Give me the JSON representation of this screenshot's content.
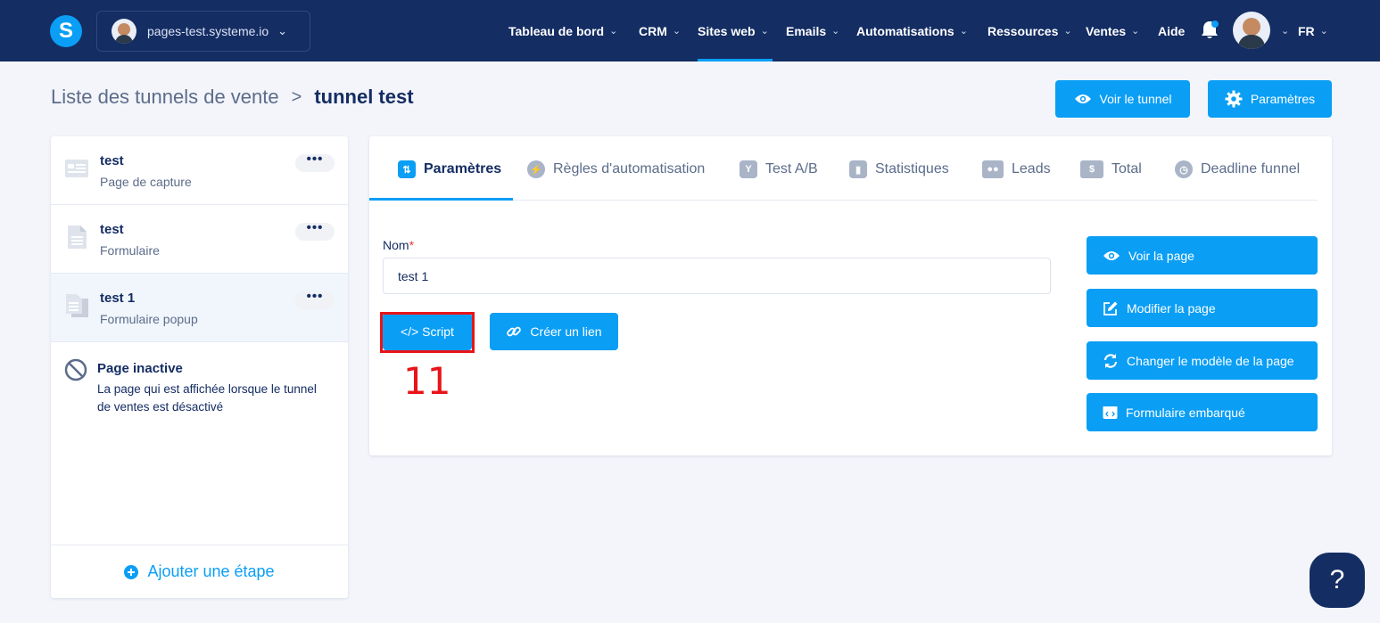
{
  "header": {
    "logo_letter": "S",
    "site_select": {
      "value": "pages-test.systeme.io"
    },
    "nav": [
      {
        "label": "Tableau de bord"
      },
      {
        "label": "CRM"
      },
      {
        "label": "Sites web"
      },
      {
        "label": "Emails"
      },
      {
        "label": "Automatisations"
      },
      {
        "label": "Ressources"
      },
      {
        "label": "Ventes"
      },
      {
        "label": "Aide"
      }
    ],
    "lang": "FR",
    "chevron": "⌄"
  },
  "breadcrumb": {
    "parent": "Liste des tunnels de vente",
    "separator": ">",
    "current": "tunnel test"
  },
  "actions": {
    "view_funnel": "Voir le tunnel",
    "settings": "Paramètres"
  },
  "steps": [
    {
      "title": "test",
      "subtitle": "Page de capture",
      "menu": "•••"
    },
    {
      "title": "test",
      "subtitle": "Formulaire",
      "menu": "•••"
    },
    {
      "title": "test 1",
      "subtitle": "Formulaire popup",
      "menu": "•••"
    }
  ],
  "inactive_page": {
    "title": "Page inactive",
    "description": "La page qui est affichée lorsque le tunnel de ventes est désactivé"
  },
  "add_step": "Ajouter une étape",
  "tabs": [
    {
      "label": "Paramètres"
    },
    {
      "label": "Règles d'automatisation"
    },
    {
      "label": "Test A/B"
    },
    {
      "label": "Statistiques"
    },
    {
      "label": "Leads"
    },
    {
      "label": "Total"
    },
    {
      "label": "Deadline funnel"
    }
  ],
  "form": {
    "name_label": "Nom",
    "required_mark": "*",
    "name_value": "test 1",
    "script_button": "</> Script",
    "link_button": "Créer un lien"
  },
  "page_actions": {
    "view": "Voir la page",
    "edit": "Modifier la page",
    "change_template": "Changer le modèle de la page",
    "embedded_form": "Formulaire embarqué"
  },
  "annotation": {
    "step_number": "11"
  },
  "help": "?",
  "colors": {
    "navy": "#142d63",
    "accent": "#0a9ef5",
    "highlight": "#e8141a",
    "background": "#f3f5fa"
  }
}
